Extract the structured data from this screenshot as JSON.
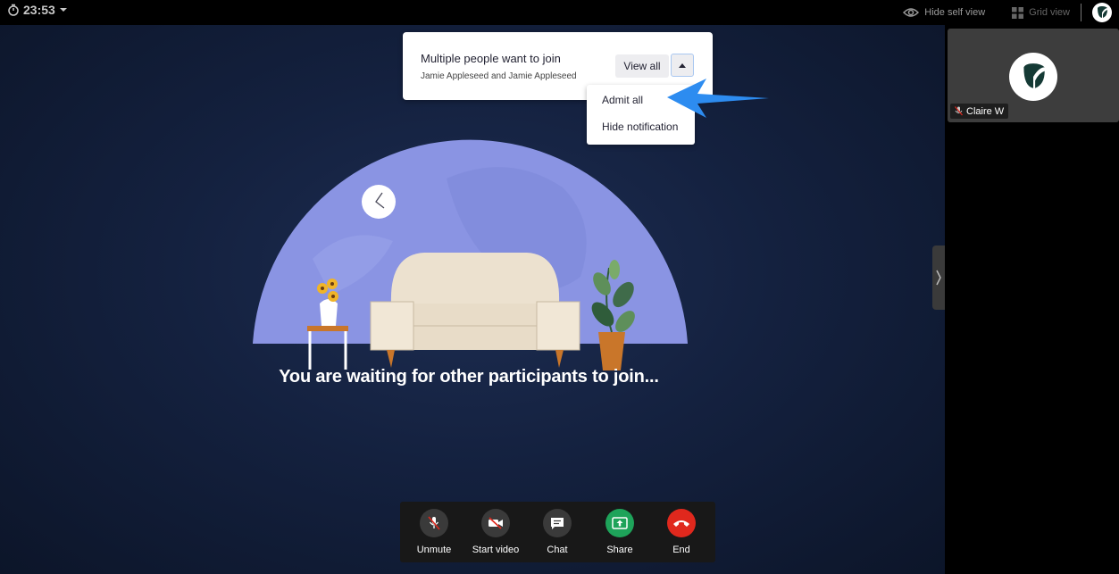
{
  "topbar": {
    "timer": "23:53",
    "hide_self_view": "Hide self view",
    "grid_view": "Grid view"
  },
  "notification": {
    "title": "Multiple people want to join",
    "subtitle": "Jamie Appleseed and Jamie Appleseed",
    "view_all": "View all",
    "menu": [
      "Admit all",
      "Hide notification"
    ]
  },
  "main": {
    "waiting_message": "You are waiting for other participants to join..."
  },
  "self_view": {
    "name": "Claire W"
  },
  "controls": [
    {
      "label": "Unmute",
      "icon": "mic-muted-icon"
    },
    {
      "label": "Start video",
      "icon": "video-off-icon"
    },
    {
      "label": "Chat",
      "icon": "chat-icon"
    },
    {
      "label": "Share",
      "icon": "share-screen-icon"
    },
    {
      "label": "End",
      "icon": "end-call-icon"
    }
  ],
  "colors": {
    "share": "#1ea35a",
    "end": "#e0281d",
    "control_bg": "#3a3a3a",
    "stage": "#14213f",
    "arrow": "#2d8cf0",
    "room_wall": "#8a94e3"
  }
}
